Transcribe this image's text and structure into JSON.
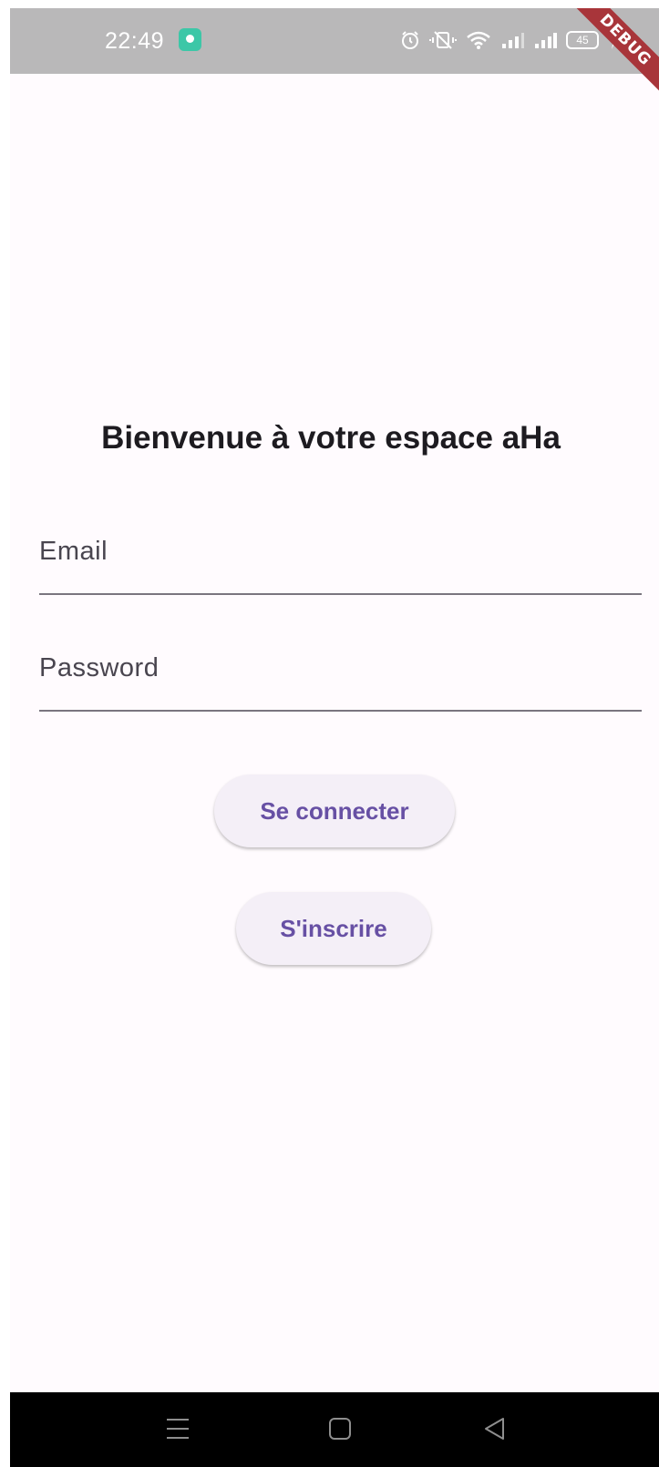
{
  "status_bar": {
    "time": "22:49",
    "battery_level": "45",
    "icons": [
      "app-notification-icon",
      "alarm-icon",
      "vibrate-icon",
      "wifi-icon",
      "signal-icon",
      "signal-icon",
      "battery-icon",
      "charging-icon"
    ]
  },
  "debug_banner": "DEBUG",
  "login": {
    "title": "Bienvenue à votre espace aHa",
    "email_label": "Email",
    "password_label": "Password",
    "login_button": "Se connecter",
    "signup_button": "S'inscrire"
  },
  "nav_bar": {
    "icons": [
      "menu-icon",
      "home-icon",
      "back-icon"
    ]
  },
  "colors": {
    "background": "#fffbfe",
    "status_bar": "#b9b8b9",
    "accent": "#6750a4",
    "button_bg": "#f4eff7",
    "debug_banner": "#a8353a"
  }
}
